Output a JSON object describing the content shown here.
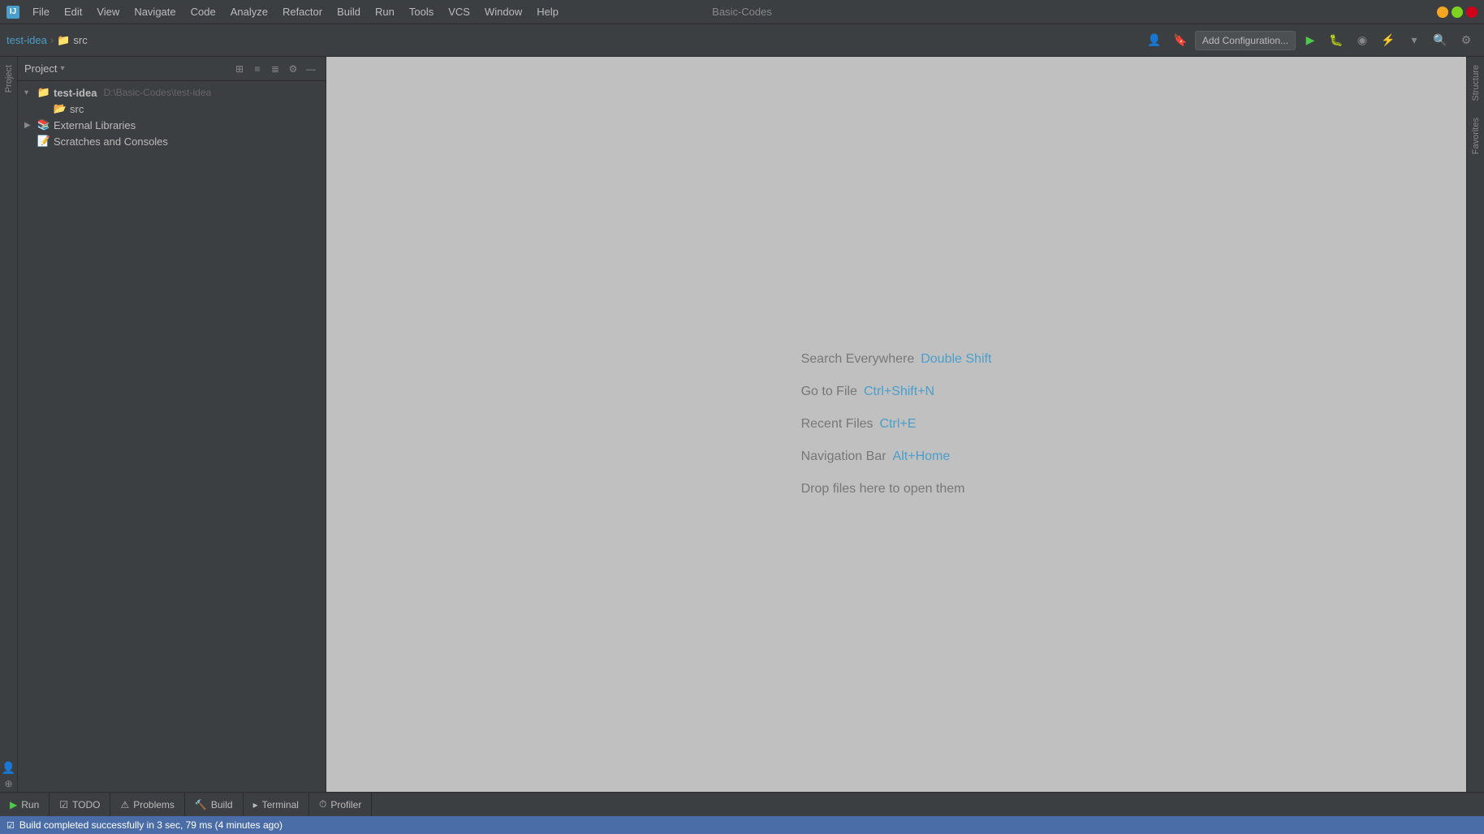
{
  "app": {
    "title": "Basic-Codes",
    "icon": "IJ"
  },
  "menu": {
    "items": [
      "File",
      "Edit",
      "View",
      "Navigate",
      "Code",
      "Analyze",
      "Refactor",
      "Build",
      "Run",
      "Tools",
      "VCS",
      "Window",
      "Help"
    ]
  },
  "breadcrumb": {
    "project": "test-idea",
    "separator1": "›",
    "folder": "src"
  },
  "toolbar": {
    "add_config_label": "Add Configuration...",
    "run_icon": "▶",
    "debug_icon": "🐛",
    "profile_icon": "⚡",
    "coverage_icon": "◉",
    "search_icon": "🔍"
  },
  "project_panel": {
    "title": "Project",
    "arrow": "▾",
    "actions": [
      "⊞",
      "≡",
      "≣",
      "⚙",
      "—"
    ]
  },
  "tree": {
    "items": [
      {
        "id": "test-idea",
        "label": "test-idea",
        "path": "D:\\Basic-Codes\\test-idea",
        "type": "root",
        "level": 0,
        "expanded": true,
        "arrow": "▾"
      },
      {
        "id": "src",
        "label": "src",
        "path": "",
        "type": "src-folder",
        "level": 1,
        "expanded": false,
        "arrow": ""
      },
      {
        "id": "external-libs",
        "label": "External Libraries",
        "path": "",
        "type": "library",
        "level": 0,
        "expanded": false,
        "arrow": "▶"
      },
      {
        "id": "scratches",
        "label": "Scratches and Consoles",
        "path": "",
        "type": "scratches",
        "level": 0,
        "expanded": false,
        "arrow": ""
      }
    ]
  },
  "left_tabs": [
    {
      "label": "Project",
      "id": "project-tab"
    }
  ],
  "right_tabs": [
    {
      "label": "Structure",
      "id": "structure-tab"
    },
    {
      "label": "Favorites",
      "id": "favorites-tab"
    }
  ],
  "editor": {
    "hints": [
      {
        "text": "Search Everywhere",
        "shortcut": "Double Shift"
      },
      {
        "text": "Go to File",
        "shortcut": "Ctrl+Shift+N"
      },
      {
        "text": "Recent Files",
        "shortcut": "Ctrl+E"
      },
      {
        "text": "Navigation Bar",
        "shortcut": "Alt+Home"
      },
      {
        "text": "Drop files here to open them",
        "shortcut": ""
      }
    ]
  },
  "bottom_tabs": [
    {
      "label": "Run",
      "icon": "▶",
      "id": "run-tab"
    },
    {
      "label": "TODO",
      "icon": "☑",
      "id": "todo-tab"
    },
    {
      "label": "Problems",
      "icon": "⚠",
      "id": "problems-tab"
    },
    {
      "label": "Build",
      "icon": "🔨",
      "id": "build-tab"
    },
    {
      "label": "Terminal",
      "icon": "▸",
      "id": "terminal-tab"
    },
    {
      "label": "Profiler",
      "icon": "⏱",
      "id": "profiler-tab"
    }
  ],
  "status_bar": {
    "icon": "☑",
    "message": "Build completed successfully in 3 sec, 79 ms (4 minutes ago)"
  },
  "colors": {
    "accent_blue": "#4a9eca",
    "bg_dark": "#3c3f41",
    "bg_editor": "#c0c0bf",
    "border": "#2b2b2b",
    "text_muted": "#777777",
    "text_normal": "#bbbbbb",
    "status_blue": "#4a6da7"
  }
}
